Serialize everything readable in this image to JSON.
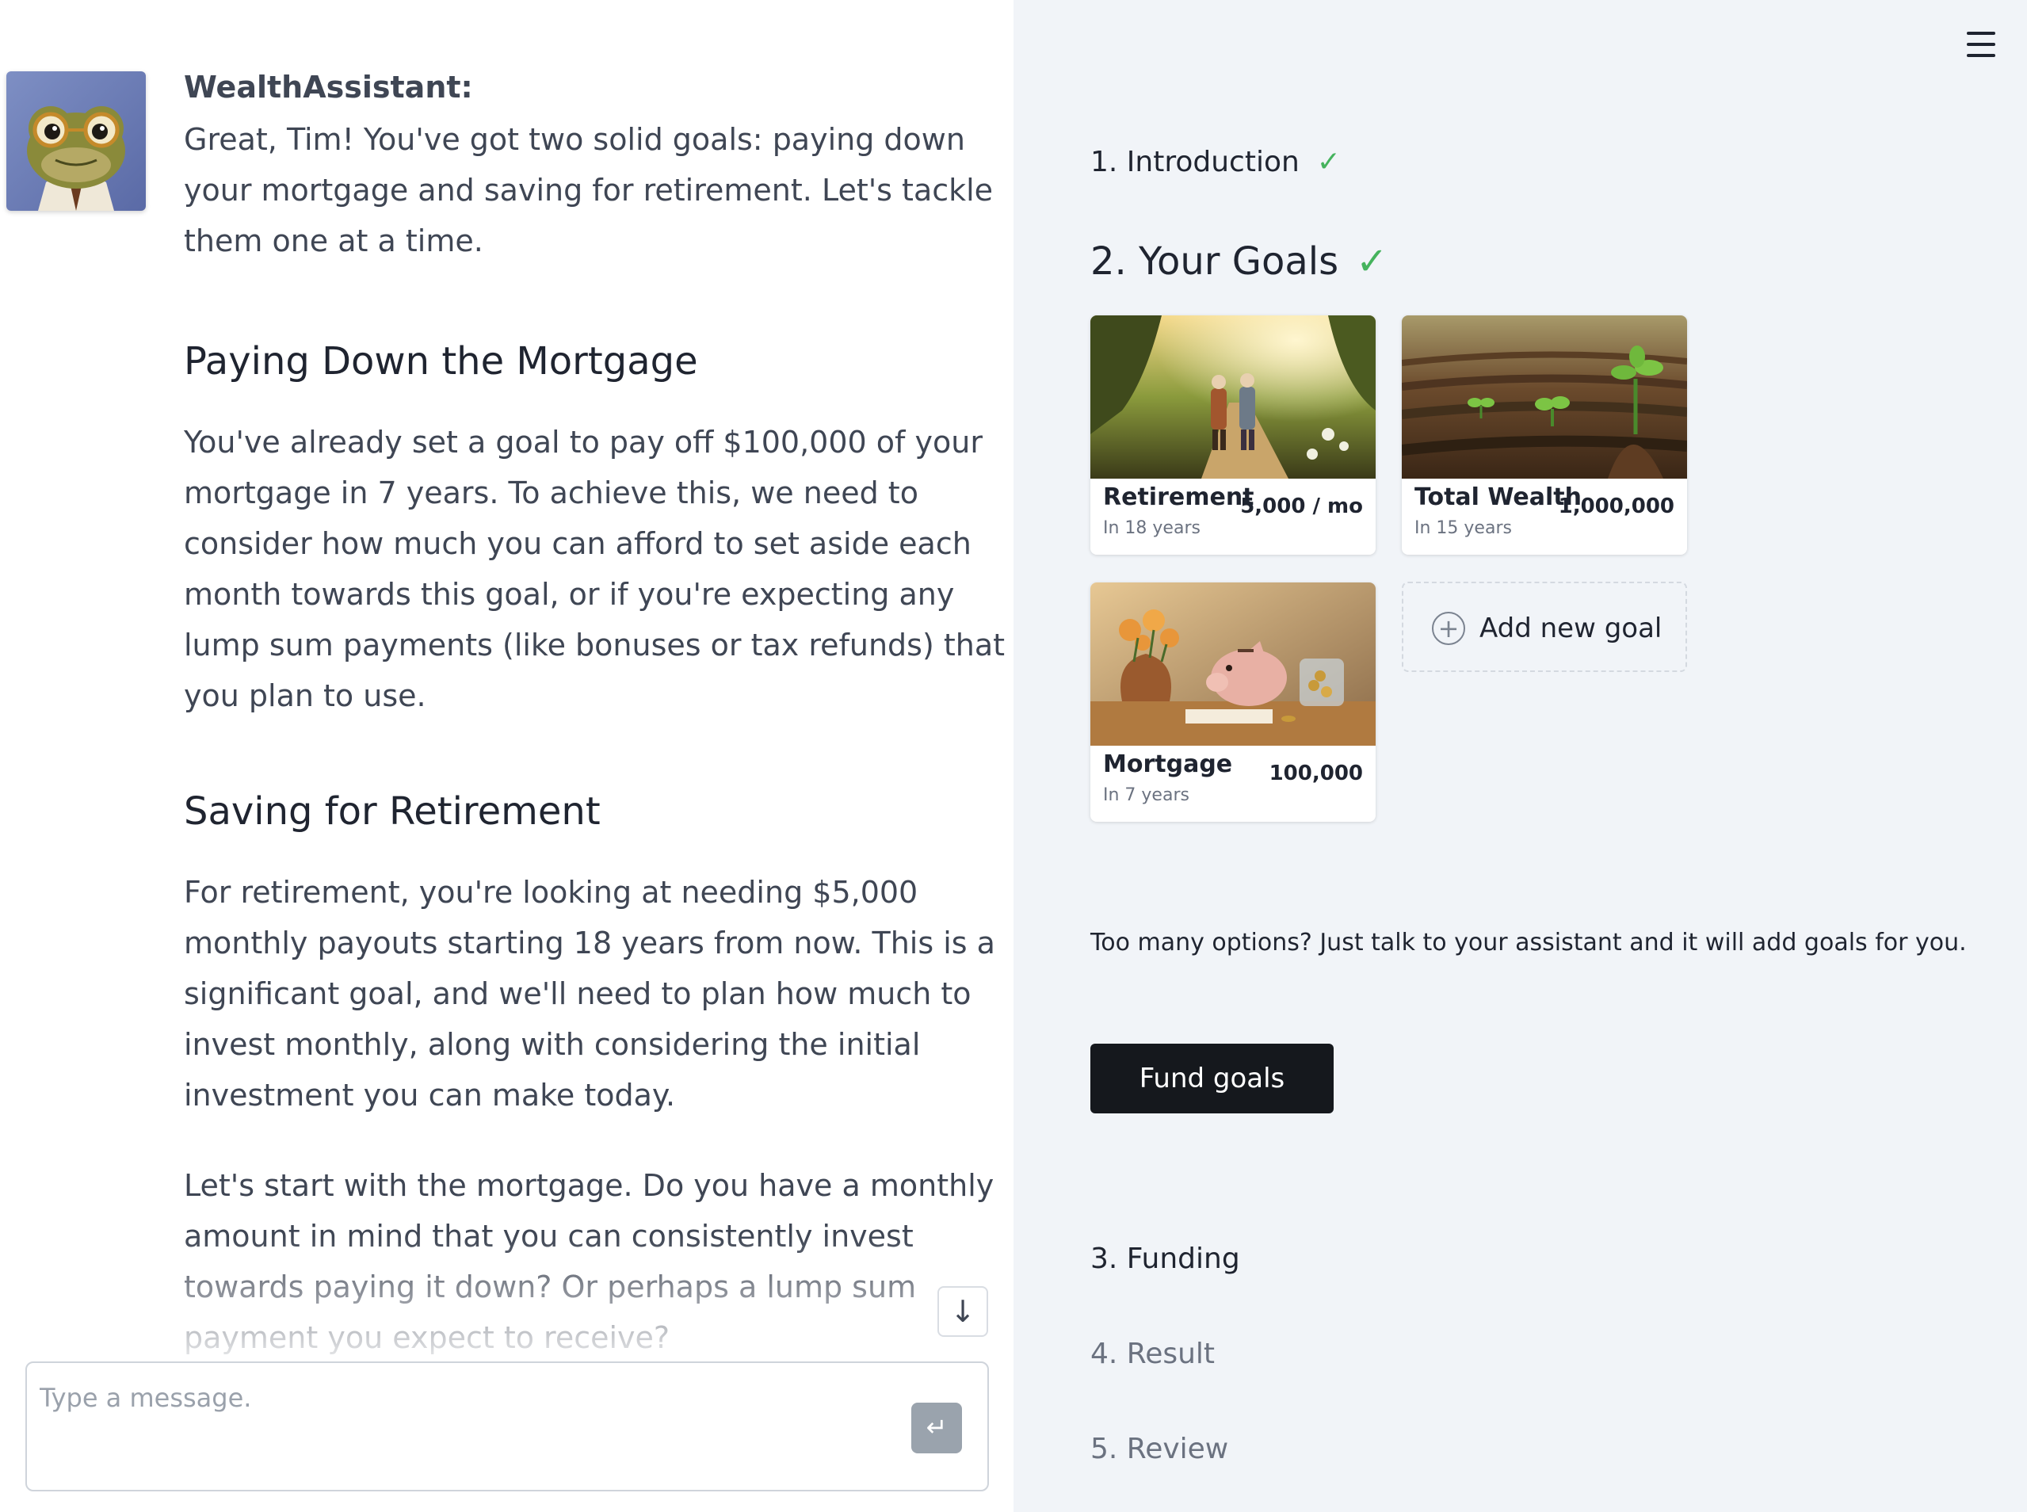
{
  "chat": {
    "sender": "WealthAssistant:",
    "para1": "Great, Tim! You've got two solid goals: paying down your mortgage and saving for retirement. Let's tackle them one at a time.",
    "heading1": "Paying Down the Mortgage",
    "para2": "You've already set a goal to pay off $100,000 of your mortgage in 7 years. To achieve this, we need to consider how much you can afford to set aside each month towards this goal, or if you're expecting any lump sum payments (like bonuses or tax refunds) that you plan to use.",
    "heading2": "Saving for Retirement",
    "para3": "For retirement, you're looking at needing $5,000 monthly payouts starting 18 years from now. This is a significant goal, and we'll need to plan how much to invest monthly, along with considering the initial investment you can make today.",
    "para4": "Let's start with the mortgage. Do you have a monthly amount in mind that you can consistently invest towards paying it down? Or perhaps a lump sum payment you expect to receive?",
    "scroll_down_icon": "arrow-down-icon",
    "input_placeholder": "Type a message.",
    "send_icon": "enter-icon"
  },
  "sidebar": {
    "menu_icon": "hamburger-menu-icon",
    "steps": [
      {
        "label": "1. Introduction",
        "done": true
      },
      {
        "label": "2. Your Goals",
        "done": true
      },
      {
        "label": "3. Funding",
        "done": false
      },
      {
        "label": "4. Result",
        "done": false
      },
      {
        "label": "5. Review",
        "done": false
      }
    ],
    "check_glyph": "✓",
    "goals": [
      {
        "name": "Retirement",
        "sub": "In 18 years",
        "amount": "5,000 / mo",
        "image": "elderly-couple-walking-path-image"
      },
      {
        "name": "Total Wealth",
        "sub": "In 15 years",
        "amount": "1,000,000",
        "image": "sprouting-plants-soil-image"
      },
      {
        "name": "Mortgage",
        "sub": "In 7 years",
        "amount": "100,000",
        "image": "piggy-bank-coins-image"
      }
    ],
    "add_goal_label": "Add new goal",
    "hint": "Too many options? Just talk to your assistant and it will add goals for you.",
    "fund_button": "Fund goals"
  },
  "colors": {
    "accent_check": "#45b35d",
    "button_dark": "#15181d",
    "sidebar_bg": "#f1f4f8"
  }
}
